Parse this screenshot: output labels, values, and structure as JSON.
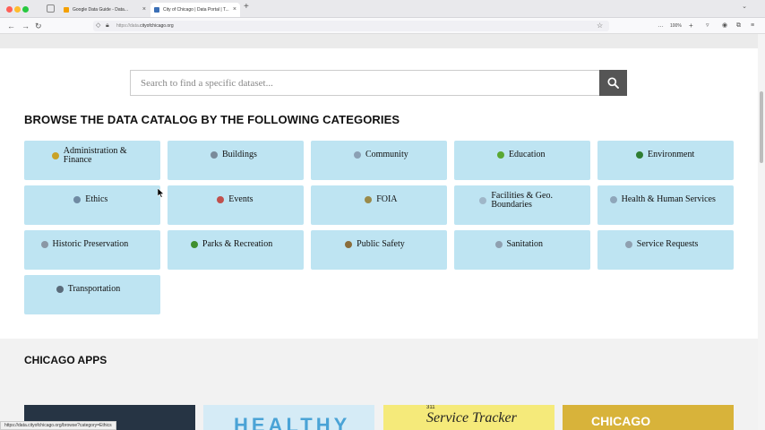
{
  "browser": {
    "tabs": [
      {
        "title": "Google Data Guide - Data..."
      },
      {
        "title": "City of Chicago | Data Portal | T..."
      }
    ],
    "url_prefix": "https://data.",
    "url_domain": "cityofchicago.org",
    "zoom": "100%",
    "status_url": "https://data.cityofchicago.org/browse?category=Ethics"
  },
  "search": {
    "placeholder": "Search to find a specific dataset..."
  },
  "catalog": {
    "heading": "BROWSE THE DATA CATALOG BY THE FOLLOWING CATEGORIES",
    "categories": [
      {
        "label_1": "Administration &",
        "label_2": "Finance",
        "icon": "bank-icon",
        "color": "#c9a227"
      },
      {
        "label_1": "Buildings",
        "label_2": "",
        "icon": "building-icon",
        "color": "#7a8a9a"
      },
      {
        "label_1": "Community",
        "label_2": "",
        "icon": "community-icon",
        "color": "#8ba0b4"
      },
      {
        "label_1": "Education",
        "label_2": "",
        "icon": "apple-icon",
        "color": "#5aa832"
      },
      {
        "label_1": "Environment",
        "label_2": "",
        "icon": "tree-icon",
        "color": "#2f7d32"
      },
      {
        "label_1": "Ethics",
        "label_2": "",
        "icon": "scales-icon",
        "color": "#6f8aa3"
      },
      {
        "label_1": "Events",
        "label_2": "",
        "icon": "calendar-icon",
        "color": "#c0504d"
      },
      {
        "label_1": "FOIA",
        "label_2": "",
        "icon": "foia-icon",
        "color": "#9a8a4a"
      },
      {
        "label_1": "Facilities & Geo.",
        "label_2": "Boundaries",
        "icon": "map-icon",
        "color": "#9fb6c8"
      },
      {
        "label_1": "Health & Human Services",
        "label_2": "",
        "icon": "health-icon",
        "color": "#8fa6ba"
      },
      {
        "label_1": "Historic Preservation",
        "label_2": "",
        "icon": "column-icon",
        "color": "#8a97a5"
      },
      {
        "label_1": "Parks & Recreation",
        "label_2": "",
        "icon": "park-icon",
        "color": "#3f8f2f"
      },
      {
        "label_1": "Public Safety",
        "label_2": "",
        "icon": "police-car-icon",
        "color": "#8a6d3b"
      },
      {
        "label_1": "Sanitation",
        "label_2": "",
        "icon": "trash-icon",
        "color": "#8fa0b0"
      },
      {
        "label_1": "Service Requests",
        "label_2": "",
        "icon": "service-icon",
        "color": "#8fa0b0"
      },
      {
        "label_1": "Transportation",
        "label_2": "",
        "icon": "bus-icon",
        "color": "#5a6b7a"
      }
    ]
  },
  "apps": {
    "title": "CHICAGO APPS",
    "cards": [
      {
        "text": ""
      },
      {
        "text": "HEALTHY"
      },
      {
        "sub": "311",
        "text": "Service Tracker"
      },
      {
        "text": "CHICAGO"
      }
    ]
  }
}
